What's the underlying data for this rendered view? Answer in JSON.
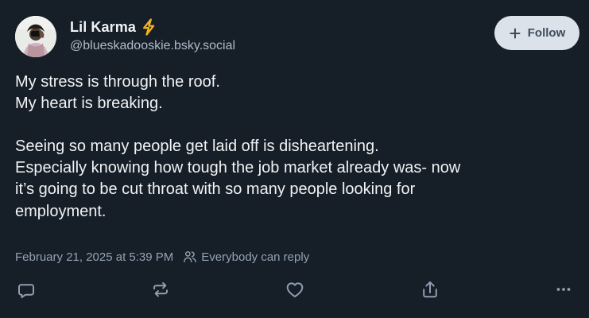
{
  "post": {
    "author": {
      "display_name": "Lil Karma",
      "handle": "@blueskadooskie.bsky.social",
      "badge_icon": "lightning-bolt-icon",
      "badge_color": "#f2b31b"
    },
    "follow_label": "Follow",
    "text_lines": [
      "My stress is through the roof.",
      "My heart is breaking.",
      "",
      "Seeing so many people get laid off is disheartening.",
      "Especially knowing how tough the job market already was- now",
      "it’s going to be cut throat with so many people looking for",
      "employment."
    ],
    "timestamp": "February 21, 2025 at 5:39 PM",
    "reply_setting": "Everybody can reply",
    "actions": {
      "reply_icon": "comment-icon",
      "repost_icon": "repost-icon",
      "like_icon": "heart-icon",
      "share_icon": "share-icon",
      "more_icon": "more-icon"
    }
  },
  "colors": {
    "background": "#161e27",
    "primary_text": "#f1f3f5",
    "secondary_text": "#93a2b4",
    "follow_background": "#dce2ea",
    "follow_text": "#3d4b5c"
  }
}
